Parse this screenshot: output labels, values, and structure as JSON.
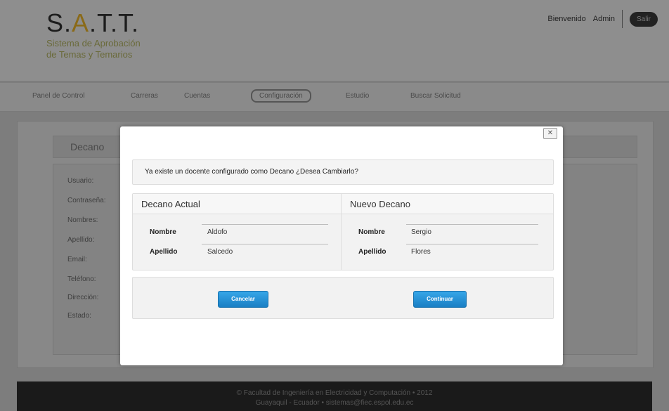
{
  "header": {
    "logo_main": "S.",
    "logo_hl": "A",
    "logo_rest": ".T.T.",
    "logo_sub1": "Sistema de Aprobación",
    "logo_sub2": "de Temas y Temarios",
    "welcome": "Bienvenido",
    "user": "Admin",
    "exit": "Salir"
  },
  "nav": {
    "items": [
      "Panel de Control",
      "Carreras",
      "Cuentas",
      "Configuración",
      "Estudio",
      "Buscar Solicitud"
    ]
  },
  "section": {
    "title": "Decano",
    "labels": [
      "Usuario:",
      "Contraseña:",
      "Nombres:",
      "Apellido:",
      "Email:",
      "Teléfono:",
      "Dirección:",
      "Estado:"
    ]
  },
  "modal": {
    "message": "Ya existe un docente configurado como Decano ¿Desea Cambiarlo?",
    "current_title": "Decano Actual",
    "new_title": "Nuevo Decano",
    "nombre_label": "Nombre",
    "apellido_label": "Apellido",
    "current_nombre": "Aldofo",
    "current_apellido": "Salcedo",
    "new_nombre": "Sergio",
    "new_apellido": "Flores",
    "cancel_label": "Cancelar",
    "continue_label": "Continuar"
  },
  "footer": {
    "line1": "© Facultad de Ingeniería en Electricidad y Computación • 2012",
    "line2": "Guayaquil - Ecuador • sistemas@fiec.espol.edu.ec"
  }
}
